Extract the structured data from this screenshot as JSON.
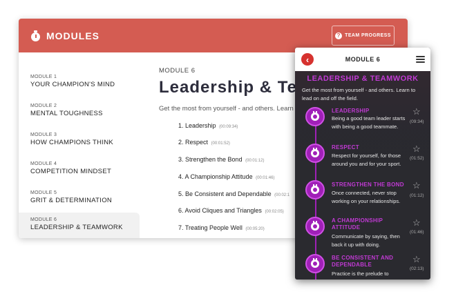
{
  "desktop": {
    "header": {
      "title": "MODULES",
      "team_progress_label": "TEAM PROGRESS",
      "accent": "#d45c52"
    },
    "sidebar": {
      "items": [
        {
          "num": "MODULE 1",
          "name": "YOUR CHAMPION'S MIND"
        },
        {
          "num": "MODULE 2",
          "name": "MENTAL TOUGHNESS"
        },
        {
          "num": "MODULE 3",
          "name": "HOW CHAMPIONS THINK"
        },
        {
          "num": "MODULE 4",
          "name": "COMPETITION MINDSET"
        },
        {
          "num": "MODULE 5",
          "name": "GRIT & DETERMINATION"
        },
        {
          "num": "MODULE 6",
          "name": "LEADERSHIP & TEAMWORK"
        }
      ],
      "active_index": 5
    },
    "main": {
      "module_label": "MODULE 6",
      "title": "Leadership & Tea",
      "description": "Get the most from yourself - and others. Learn",
      "lessons": [
        {
          "label": "1. Leadership",
          "duration": "(00:09:34)"
        },
        {
          "label": "2. Respect",
          "duration": "(00:01:52)"
        },
        {
          "label": "3. Strengthen the Bond",
          "duration": "(00:01:12)"
        },
        {
          "label": "4. A Championship Attitude",
          "duration": "(00:01:46)"
        },
        {
          "label": "5. Be Consistent and Dependable",
          "duration": "(00:02:1"
        },
        {
          "label": "6. Avoid Cliques and Triangles",
          "duration": "(00:02:05)"
        },
        {
          "label": "7. Treating People Well",
          "duration": "(00:05:20)"
        }
      ]
    }
  },
  "mobile": {
    "header_title": "MODULE 6",
    "back_icon": "chevron-left-icon",
    "menu_icon": "hamburger-menu-icon",
    "heading": "LEADERSHIP & TEAMWORK",
    "description": "Get the most from yourself - and others. Learn to lead on and off the field.",
    "accent": "#c13ad4",
    "lessons": [
      {
        "title": "LEADERSHIP",
        "text": "Being a good team leader starts with being a good teammate.",
        "duration": "(09:34)"
      },
      {
        "title": "RESPECT",
        "text": "Respect for yourself, for those around you and for your sport.",
        "duration": "(01:52)"
      },
      {
        "title": "STRENGTHEN THE BOND",
        "text": "Once connected, never stop working on your relationships.",
        "duration": "(01:12)"
      },
      {
        "title": "A CHAMPIONSHIP ATTITUDE",
        "text": "Communicate by saying, then back it up with doing.",
        "duration": "(01:46)"
      },
      {
        "title": "BE CONSISTENT AND DEPENDABLE",
        "text": "Practice is the prelude to",
        "duration": "(02:13)"
      }
    ]
  }
}
